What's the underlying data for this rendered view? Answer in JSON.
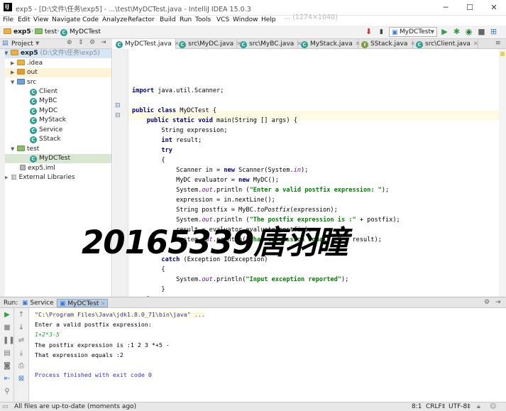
{
  "window": {
    "title": "exp5 - [D:\\文件\\任务\\exp5] - ...\\test\\MyDCTest.java - IntelliJ IDEA 15.0.3",
    "minimize": "─",
    "maximize": "☐",
    "close": "✕"
  },
  "menu": [
    "File",
    "Edit",
    "View",
    "Navigate",
    "Code",
    "Analyze",
    "Refactor",
    "Build",
    "Run",
    "Tools",
    "VCS",
    "Window",
    "Help"
  ],
  "menu_watermark": "... (1274×1040)",
  "breadcrumb": [
    "exp5",
    "test",
    "MyDCTest"
  ],
  "run_config": "MyDCTest",
  "project_panel": {
    "label": "Project"
  },
  "tree": [
    {
      "label": "exp5",
      "suffix": " (D:\\文件\\任务\\exp5)",
      "depth": 0,
      "arrow": "▼",
      "kind": "folder",
      "selected": true
    },
    {
      "label": ".idea",
      "depth": 1,
      "arrow": "▶",
      "kind": "folder"
    },
    {
      "label": "out",
      "depth": 1,
      "arrow": "▶",
      "kind": "folder"
    },
    {
      "label": "src",
      "depth": 1,
      "arrow": "▼",
      "kind": "folder-blue"
    },
    {
      "label": "Client",
      "depth": 2,
      "kind": "class"
    },
    {
      "label": "MyBC",
      "depth": 2,
      "kind": "class"
    },
    {
      "label": "MyDC",
      "depth": 2,
      "kind": "class"
    },
    {
      "label": "MyStack",
      "depth": 2,
      "kind": "class"
    },
    {
      "label": "Service",
      "depth": 2,
      "kind": "class"
    },
    {
      "label": "SStack",
      "depth": 2,
      "kind": "class"
    },
    {
      "label": "test",
      "depth": 1,
      "arrow": "▼",
      "kind": "folder-green"
    },
    {
      "label": "MyDCTest",
      "depth": 2,
      "kind": "class",
      "selected2": true
    },
    {
      "label": "exp5.iml",
      "depth": 1,
      "kind": "file"
    },
    {
      "label": "External Libraries",
      "depth": 0,
      "arrow": "▶",
      "kind": "lib"
    }
  ],
  "editor_tabs": [
    {
      "label": "MyDCTest.java",
      "active": true
    },
    {
      "label": "src\\MyDC.java"
    },
    {
      "label": "src\\MyBC.java"
    },
    {
      "label": "MyStack.java"
    },
    {
      "label": "SStack.java"
    },
    {
      "label": "src\\Client.java"
    }
  ],
  "code": [
    "",
    "",
    "",
    "import java.util.Scanner;",
    "",
    "public class MyDCTest {",
    "    public static void main(String [] args) {",
    "        String expression;",
    "        int result;",
    "        try",
    "        {",
    "            Scanner in = new Scanner(System.in);",
    "            MyDC evaluator = new MyDC();",
    "            System.out.println (\"Enter a valid postfix expression: \");",
    "            expression = in.nextLine();",
    "            String postfix = MyBC.toPostfix(expression);",
    "            System.out.println (\"The postfix expression is :\" + postfix);",
    "            result = evaluator.evaluate(postfix);",
    "            System.out.println(\"That expression equals :\" + result);",
    "        }",
    "        catch (Exception IOException)",
    "        {",
    "            System.out.println(\"Input exception reported\");",
    "        }",
    "    }"
  ],
  "overlay": "20165339唐羽瞳",
  "run": {
    "label": "Run:",
    "tabs": [
      "Service",
      "MyDCTest"
    ],
    "console": [
      "\"C:\\Program Files\\Java\\jdk1.8.0_71\\bin\\java\" ...",
      "Enter a valid postfix expression:",
      "1+2*3-5",
      "The postfix expression is :1 2 3 *+5 -",
      "That expression equals :2",
      "",
      "Process finished with exit code 0"
    ]
  },
  "status": {
    "message": "All files are up-to-date (moments ago)",
    "position": "8:1",
    "line_sep": "CRLF‡",
    "encoding": "UTF-8‡"
  }
}
